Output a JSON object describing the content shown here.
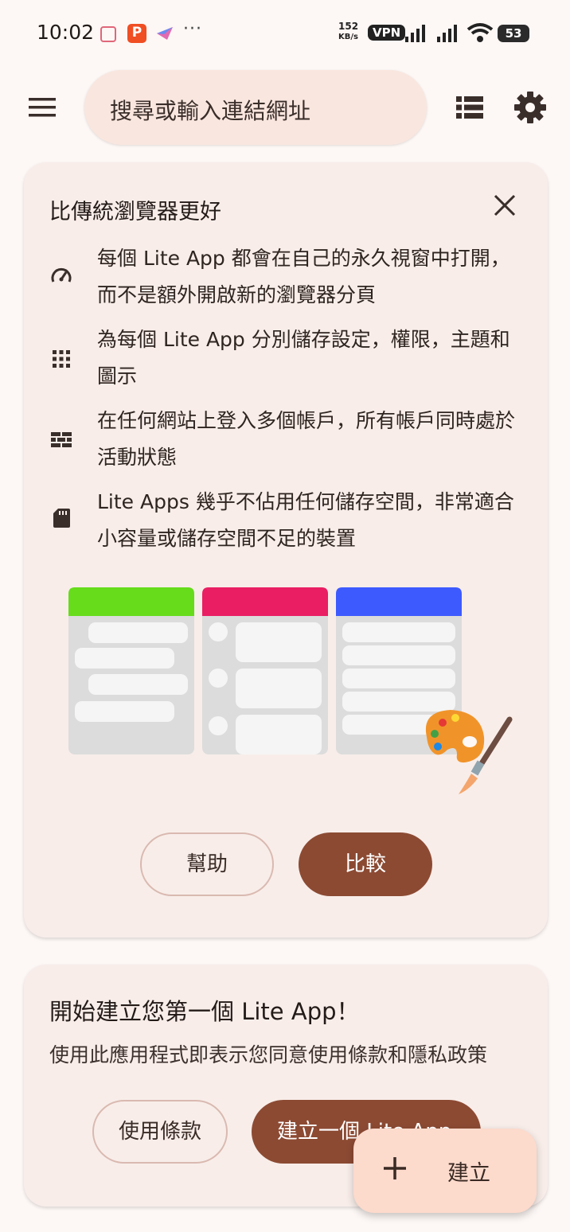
{
  "status_bar": {
    "time": "10:02",
    "app_badge": "P",
    "more": "···",
    "speed_value": "152",
    "speed_unit": "KB/s",
    "vpn": "VPN",
    "battery": "53"
  },
  "search": {
    "placeholder": "搜尋或輸入連結網址"
  },
  "intro_card": {
    "title": "比傳統瀏覽器更好",
    "features": [
      {
        "icon": "speedometer-icon",
        "text": "每個 Lite App 都會在自己的永久視窗中打開，而不是額外開啟新的瀏覽器分頁"
      },
      {
        "icon": "grid-apps-icon",
        "text": "為每個 Lite App 分別儲存設定，權限，主題和圖示"
      },
      {
        "icon": "wall-icon",
        "text": "在任何網站上登入多個帳戶，所有帳戶同時處於活動狀態"
      },
      {
        "icon": "sd-card-icon",
        "text": "Lite Apps 幾乎不佔用任何儲存空間，非常適合小容量或儲存空間不足的裝置"
      }
    ],
    "illustration_colors": [
      "#66dc1b",
      "#e91e63",
      "#3d5afe"
    ],
    "help_button": "幫助",
    "compare_button": "比較"
  },
  "start_card": {
    "title": "開始建立您第一個 Lite App！",
    "subtitle": "使用此應用程式即表示您同意使用條款和隱私政策",
    "terms_button": "使用條款",
    "create_button": "建立一個 Lite App"
  },
  "fab": {
    "label": "建立"
  },
  "colors": {
    "accent": "#8c4a33",
    "card": "#f8ede9",
    "background": "#fdf7f5",
    "fab": "#fcdacc"
  }
}
